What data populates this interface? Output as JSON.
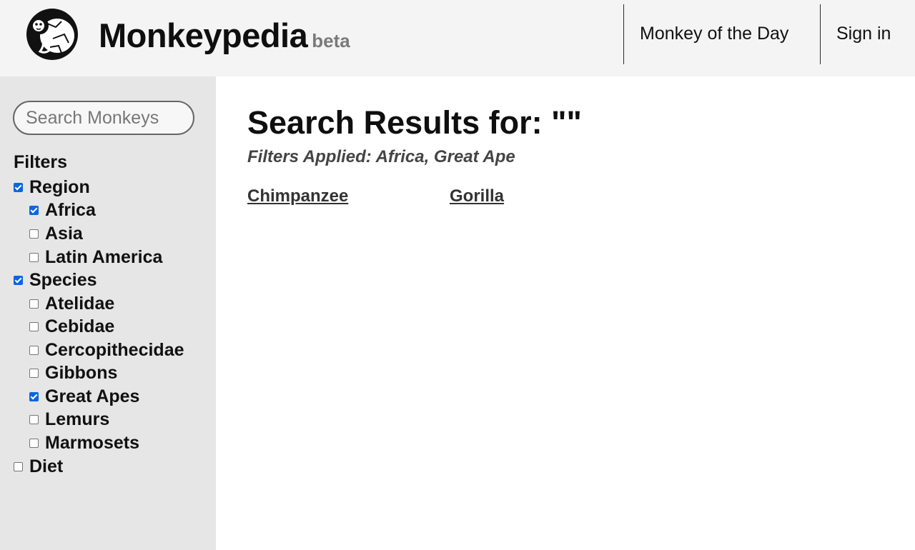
{
  "header": {
    "brand_name": "Monkeypedia",
    "brand_tag": "beta",
    "logo_icon": "monkey-globe-logo",
    "nav": {
      "monkey_of_the_day": "Monkey of the Day",
      "sign_in": "Sign in"
    }
  },
  "sidebar": {
    "search": {
      "placeholder": "Search Monkeys",
      "value": ""
    },
    "filters_title": "Filters",
    "filters": {
      "region": {
        "label": "Region",
        "checked": true
      },
      "africa": {
        "label": "Africa",
        "checked": true
      },
      "asia": {
        "label": "Asia",
        "checked": false
      },
      "latin_america": {
        "label": "Latin America",
        "checked": false
      },
      "species": {
        "label": "Species",
        "checked": true
      },
      "atelidae": {
        "label": "Atelidae",
        "checked": false
      },
      "cebidae": {
        "label": "Cebidae",
        "checked": false
      },
      "cercopithecidae": {
        "label": "Cercopithecidae",
        "checked": false
      },
      "gibbons": {
        "label": "Gibbons",
        "checked": false
      },
      "great_apes": {
        "label": "Great Apes",
        "checked": true
      },
      "lemurs": {
        "label": "Lemurs",
        "checked": false
      },
      "marmosets": {
        "label": "Marmosets",
        "checked": false
      },
      "diet": {
        "label": "Diet",
        "checked": false
      }
    }
  },
  "main": {
    "results_title": "Search Results for: \"\"",
    "filters_applied": "Filters Applied: Africa, Great Ape",
    "results": {
      "chimpanzee": "Chimpanzee",
      "gorilla": "Gorilla"
    }
  },
  "colors": {
    "header_bg": "#f4f4f4",
    "sidebar_bg": "#e6e6e6",
    "checkbox_accent": "#0a66e0"
  }
}
